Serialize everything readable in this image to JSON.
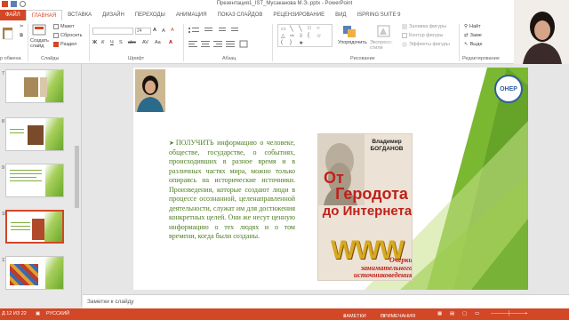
{
  "window": {
    "title": "Презентация1_IST_Мусаканова М.Э..pptx - PowerPoint"
  },
  "tabs": [
    {
      "label": "ФАЙЛ"
    },
    {
      "label": "ГЛАВНАЯ"
    },
    {
      "label": "ВСТАВКА"
    },
    {
      "label": "ДИЗАЙН"
    },
    {
      "label": "ПЕРЕХОДЫ"
    },
    {
      "label": "АНИМАЦИЯ"
    },
    {
      "label": "ПОКАЗ СЛАЙДОВ"
    },
    {
      "label": "РЕЦЕНЗИРОВАНИЕ"
    },
    {
      "label": "ВИД"
    },
    {
      "label": "ISPRING SUITE 9"
    }
  ],
  "ribbon": {
    "slides": {
      "create_slide": "Создать слайд",
      "layout": "Макет",
      "reset": "Сбросить",
      "section": "Раздел",
      "group_label": "Слайды"
    },
    "clipboard": {
      "group_label": "р обмена"
    },
    "font": {
      "size_value": "24",
      "group_label": "Шрифт"
    },
    "paragraph": {
      "group_label": "Абзац"
    },
    "drawing": {
      "arrange": "Упорядочить",
      "quick_styles": "Экспресс-стили",
      "shape_fill": "Заливка фигуры",
      "shape_outline": "Контур фигуры",
      "shape_effects": "Эффекты фигуры",
      "group_label": "Рисование"
    },
    "editing": {
      "find": "Найт",
      "replace": "Заме",
      "select": "Выде",
      "group_label": "Редактирование"
    }
  },
  "thumbnails": [
    {
      "number": "7"
    },
    {
      "number": "8"
    },
    {
      "number": "9"
    },
    {
      "number": "10"
    },
    {
      "number": "11"
    }
  ],
  "slide": {
    "logo_text": "ОНЕР",
    "body_text": "ПОЛУЧИТЬ информацию о человеке, обществе, государстве, о событиях, происходивших в разное время и в различных частях мира, можно только опираясь на исторические источники. Произведения, которые создают люди в процессе осознанной, целенаправленной деятельности, служат им для достижения конкретных целей. Они же несут ценную информацию о тех людях и о том времени, когда были созданы.",
    "book": {
      "author": "Владимир БОГДАНОВ",
      "title_line1": "От",
      "title_line2": "Геродота",
      "title_line3": "до Интернета",
      "www": "WWW",
      "subtitle": "Очерки занимательного источниковедения"
    }
  },
  "notes": {
    "placeholder": "Заметки к слайду"
  },
  "status": {
    "slide_counter": "Д 12 ИЗ 22",
    "language": "РУССКИЙ",
    "notes_button": "ЗАМЕТКИ",
    "comments_button": "ПРИМЕЧАНИЯ"
  },
  "colors": {
    "accent": "#d24726",
    "slide_text": "#4c7d1f",
    "slide_green": "#6aa82a"
  }
}
